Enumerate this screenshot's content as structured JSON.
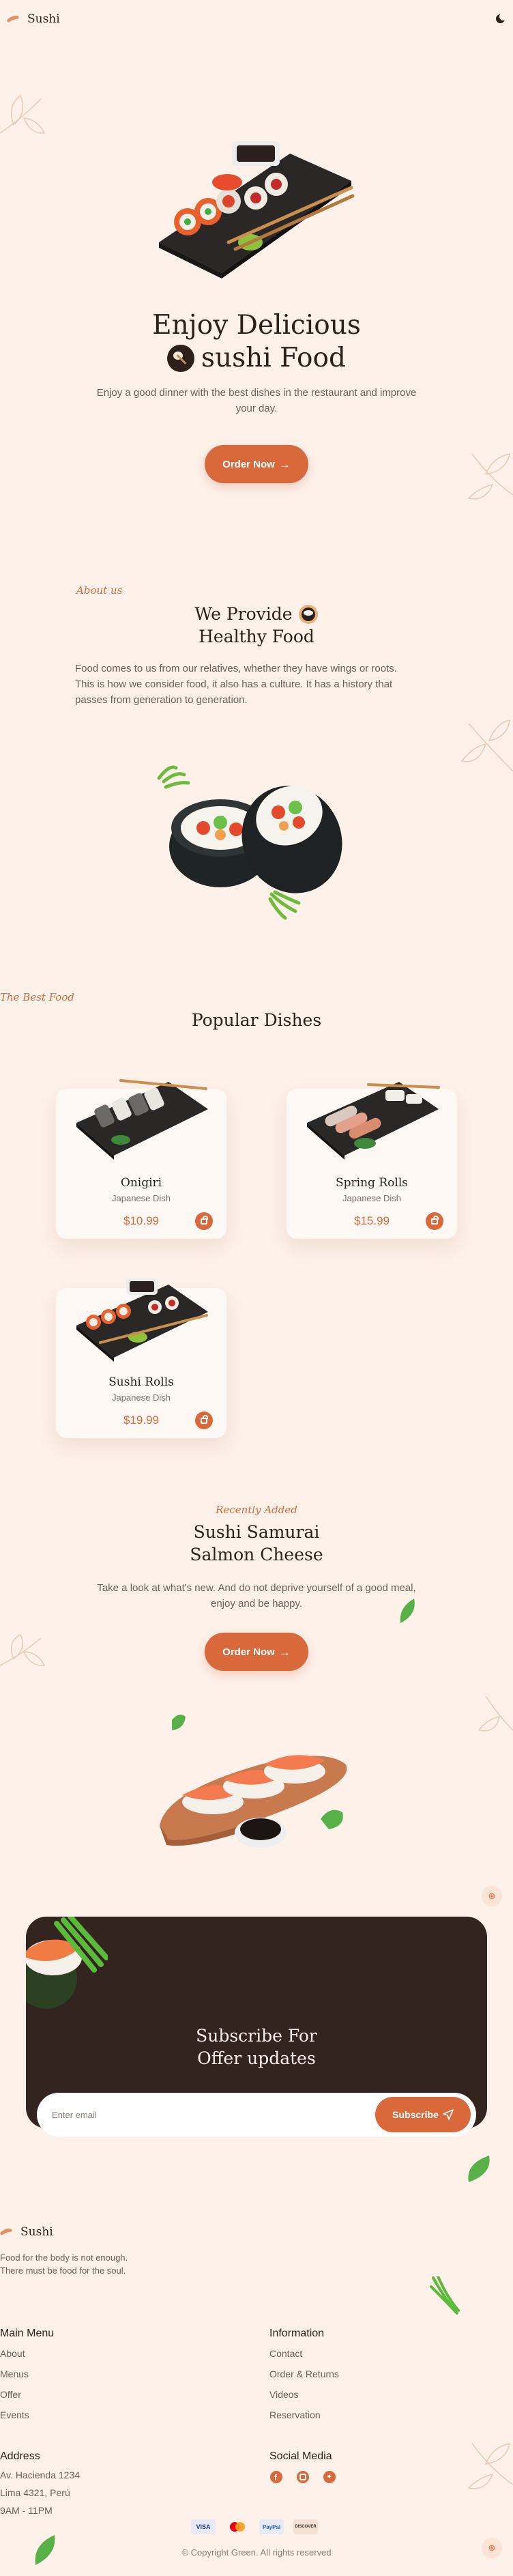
{
  "header": {
    "logo_text": "Sushi",
    "theme_icon": "moon-icon"
  },
  "hero": {
    "title_line1": "Enjoy Delicious",
    "title_line2": "sushi Food",
    "description": "Enjoy a good dinner with the best dishes in the restaurant and improve your day.",
    "order_button": "Order Now"
  },
  "about": {
    "label": "About us",
    "title_line1": "We Provide",
    "title_line2": "Healthy Food",
    "description": "Food comes to us from our relatives, whether they have wings or roots. This is how we consider food, it also has a culture. It has a history that passes from generation to generation."
  },
  "popular": {
    "label": "The Best Food",
    "title": "Popular Dishes",
    "dishes": [
      {
        "name": "Onigiri",
        "type": "Japanese Dish",
        "price": "$10.99"
      },
      {
        "name": "Spring Rolls",
        "type": "Japanese Dish",
        "price": "$15.99"
      },
      {
        "name": "Sushi Rolls",
        "type": "Japanese Dish",
        "price": "$19.99"
      }
    ]
  },
  "recent": {
    "label": "Recently Added",
    "title_line1": "Sushi Samurai",
    "title_line2": "Salmon Cheese",
    "description": "Take a look at what's new. And do not deprive yourself of a good meal, enjoy and be happy.",
    "order_button": "Order Now"
  },
  "subscribe": {
    "title_line1": "Subscribe For",
    "title_line2": "Offer updates",
    "placeholder": "Enter email",
    "button": "Subscribe"
  },
  "footer": {
    "logo_text": "Sushi",
    "tagline": "Food for the body is not enough. There must be food for the soul.",
    "main_menu": {
      "title": "Main Menu",
      "links": [
        "About",
        "Menus",
        "Offer",
        "Events"
      ]
    },
    "information": {
      "title": "Information",
      "links": [
        "Contact",
        "Order & Returns",
        "Videos",
        "Reservation"
      ]
    },
    "address": {
      "title": "Address",
      "lines": [
        "Av. Hacienda 1234",
        "Lima 4321, Perú",
        "9AM - 11PM"
      ]
    },
    "social": {
      "title": "Social Media",
      "icons": [
        "facebook-icon",
        "instagram-icon",
        "twitter-icon"
      ]
    },
    "payments": [
      "VISA",
      "mastercard",
      "PayPal",
      "DISCOVER"
    ],
    "copyright": "© Copyright Green. All rights reserved"
  },
  "colors": {
    "accent": "#d9683b",
    "background": "#fdf1ea",
    "dark": "#332420"
  }
}
